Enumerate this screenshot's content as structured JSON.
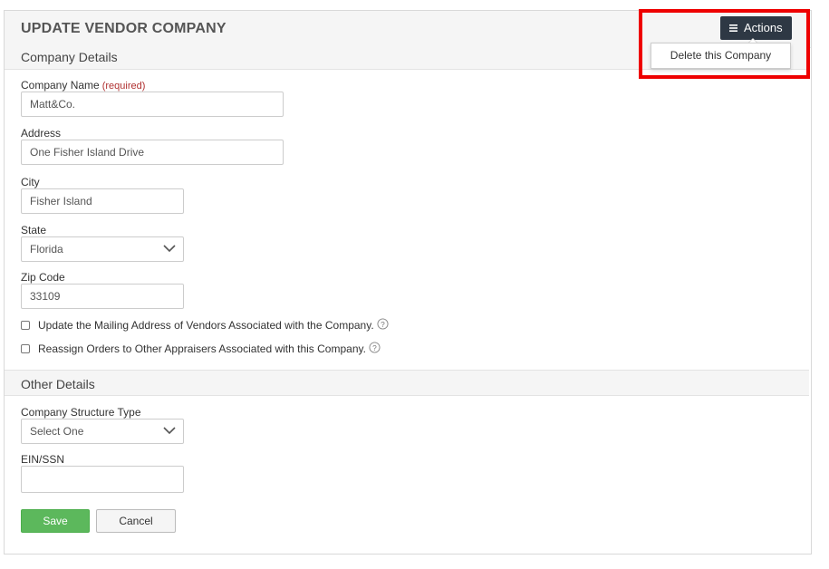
{
  "header": {
    "title": "UPDATE VENDOR COMPANY"
  },
  "actions": {
    "button_label": "Actions",
    "menu_items": [
      {
        "label": "Delete this Company"
      }
    ]
  },
  "company_details": {
    "section_title": "Company Details",
    "company_name": {
      "label": "Company Name",
      "required_label": "(required)",
      "value": "Matt&Co."
    },
    "address": {
      "label": "Address",
      "value": "One Fisher Island Drive"
    },
    "city": {
      "label": "City",
      "value": "Fisher Island"
    },
    "state": {
      "label": "State",
      "value": "Florida"
    },
    "zip": {
      "label": "Zip Code",
      "value": "33109"
    },
    "checkboxes": [
      {
        "label": "Update the Mailing Address of Vendors Associated with the Company.",
        "checked": false
      },
      {
        "label": "Reassign Orders to Other Appraisers Associated with this Company.",
        "checked": false
      }
    ]
  },
  "other_details": {
    "section_title": "Other Details",
    "structure_type": {
      "label": "Company Structure Type",
      "value": "Select One"
    },
    "ein": {
      "label": "EIN/SSN",
      "value": ""
    }
  },
  "buttons": {
    "save": "Save",
    "cancel": "Cancel"
  },
  "colors": {
    "save": "#5cb85c",
    "actions": "#2e3844",
    "required": "#b03030",
    "highlight": "#ee0000"
  }
}
